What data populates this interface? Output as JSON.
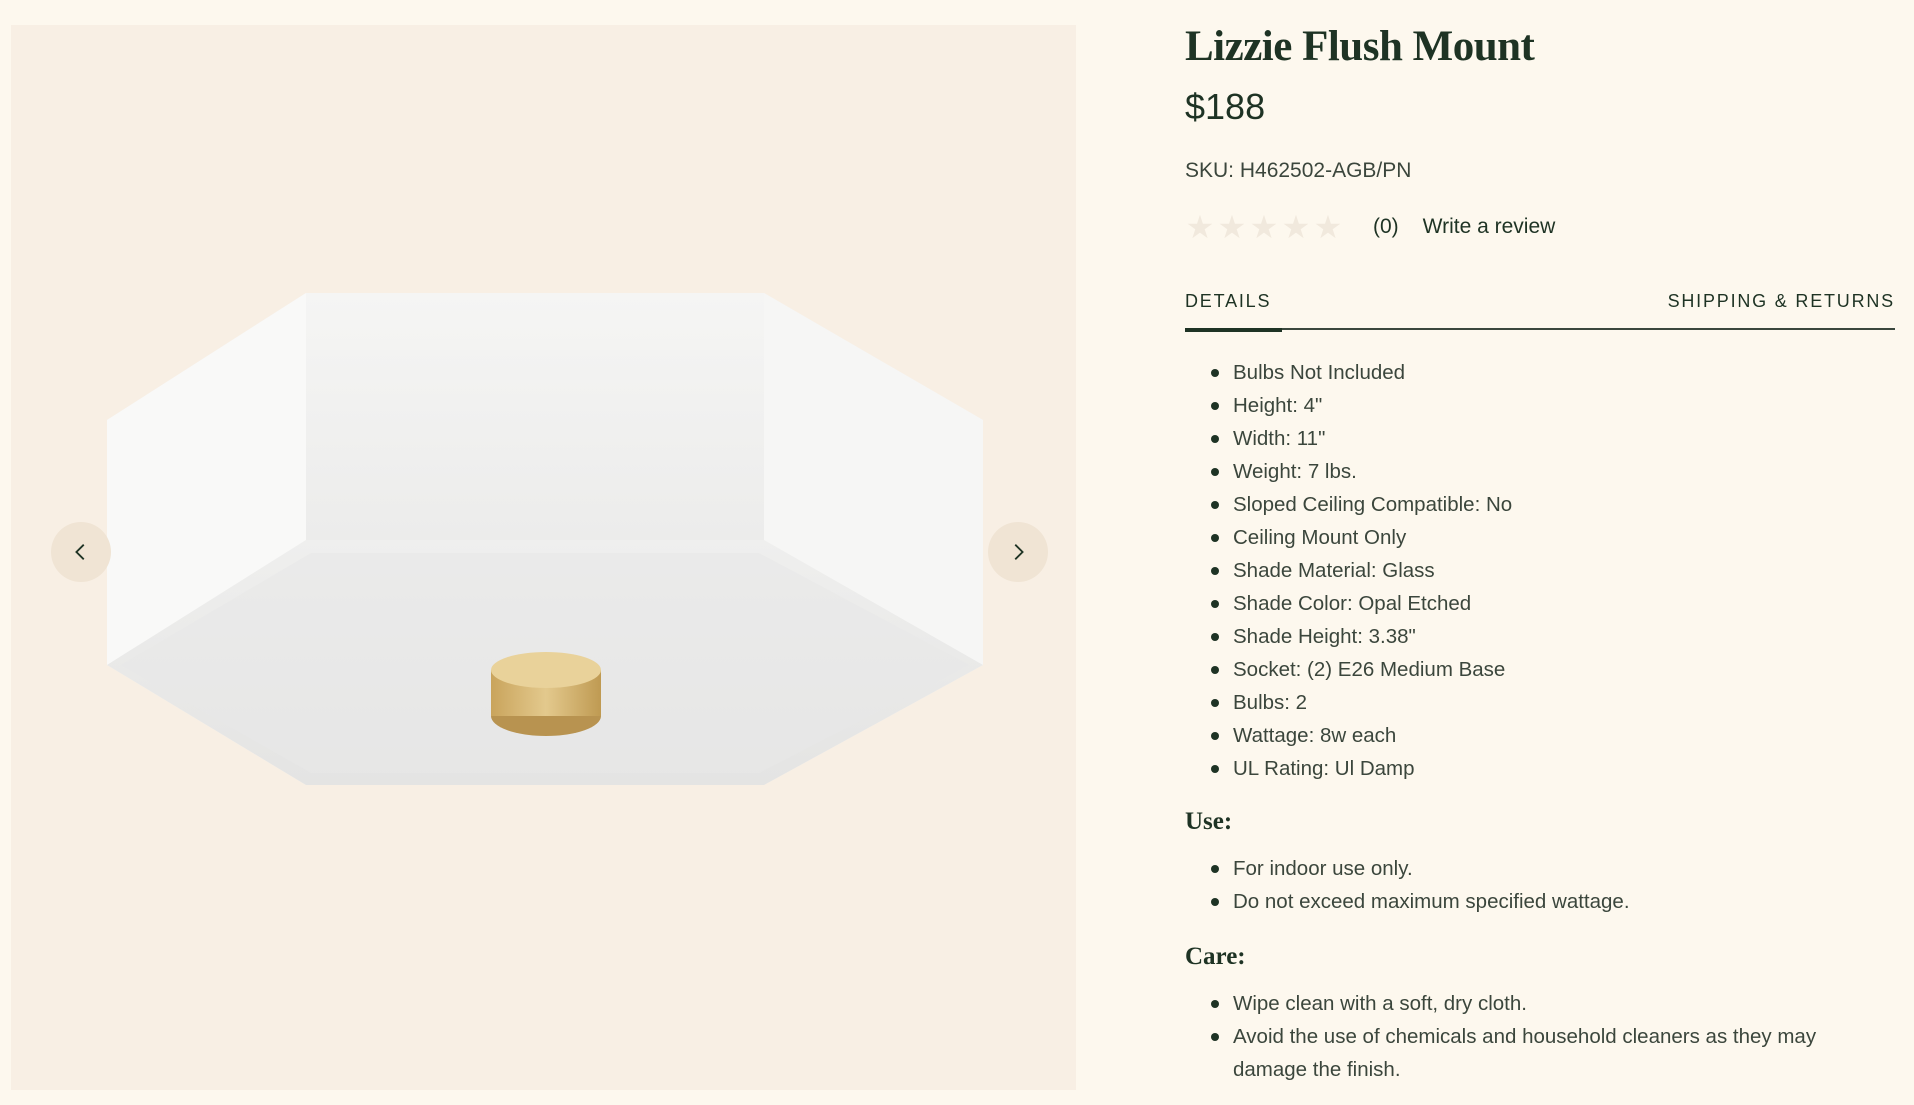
{
  "product": {
    "title": "Lizzie Flush Mount",
    "price": "$188",
    "sku": "SKU: H462502-AGB/PN",
    "rating_count": "(0)",
    "write_review_label": "Write a review"
  },
  "tabs": [
    {
      "label": "DETAILS",
      "active": true
    },
    {
      "label": "SHIPPING & RETURNS",
      "active": false
    }
  ],
  "details": [
    "Bulbs Not Included",
    "Height: 4\"",
    "Width: 11\"",
    "Weight: 7 lbs.",
    "Sloped Ceiling Compatible: No",
    "Ceiling Mount Only",
    "Shade Material: Glass",
    "Shade Color: Opal Etched",
    "Shade Height: 3.38\"",
    "Socket: (2) E26 Medium Base",
    "Bulbs: 2",
    "Wattage: 8w each",
    "UL Rating: Ul Damp"
  ],
  "use": {
    "heading": "Use:",
    "items": [
      "For indoor use only.",
      "Do not exceed maximum specified wattage."
    ]
  },
  "care": {
    "heading": "Care:",
    "items": [
      "Wipe clean with a soft, dry cloth.",
      "Avoid the use of chemicals and household cleaners as they may damage the finish."
    ]
  },
  "gallery": {
    "prev_icon": "chevron-left-icon",
    "next_icon": "chevron-right-icon"
  },
  "colors": {
    "background": "#fdf8ee",
    "gallery_bg": "#f8efe4",
    "text_dark": "#1e3324",
    "text_body": "#3b463c",
    "accent_brass": "#d4b36e"
  }
}
